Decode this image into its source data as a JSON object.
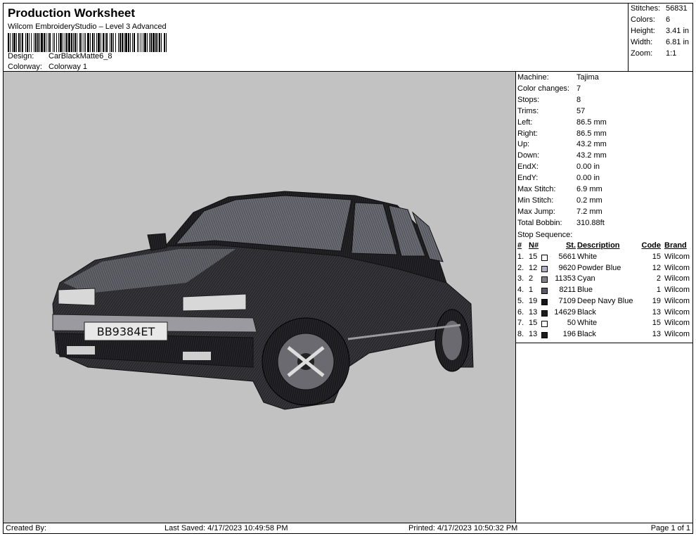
{
  "header": {
    "title": "Production Worksheet",
    "subtitle": "Wilcom EmbroideryStudio – Level 3 Advanced",
    "design_label": "Design:",
    "design_value": "CarBlackMatte6_8",
    "colorway_label": "Colorway:",
    "colorway_value": "Colorway 1"
  },
  "stats": [
    {
      "label": "Stitches:",
      "value": "56831"
    },
    {
      "label": "Colors:",
      "value": "6"
    },
    {
      "label": "Height:",
      "value": "3.41 in"
    },
    {
      "label": "Width:",
      "value": "6.81 in"
    },
    {
      "label": "Zoom:",
      "value": "1:1"
    }
  ],
  "machine_info": [
    {
      "label": "Machine:",
      "value": "Tajima"
    },
    {
      "label": "Color changes:",
      "value": "7"
    },
    {
      "label": "Stops:",
      "value": "8"
    },
    {
      "label": "Trims:",
      "value": "57"
    },
    {
      "label": "Left:",
      "value": "86.5 mm"
    },
    {
      "label": "Right:",
      "value": "86.5 mm"
    },
    {
      "label": "Up:",
      "value": "43.2 mm"
    },
    {
      "label": "Down:",
      "value": "43.2 mm"
    },
    {
      "label": "EndX:",
      "value": "0.00 in"
    },
    {
      "label": "EndY:",
      "value": "0.00 in"
    },
    {
      "label": "Max Stitch:",
      "value": "6.9 mm"
    },
    {
      "label": "Min Stitch:",
      "value": "0.2 mm"
    },
    {
      "label": "Max Jump:",
      "value": "7.2 mm"
    },
    {
      "label": "Total Bobbin:",
      "value": "310.88ft"
    }
  ],
  "stop_sequence": {
    "title": "Stop Sequence:",
    "headers": {
      "num": "#",
      "n": "N#",
      "st": "St.",
      "desc": "Description",
      "code": "Code",
      "brand": "Brand"
    },
    "rows": [
      {
        "num": "1.",
        "n": "15",
        "st": "5661",
        "desc": "White",
        "code": "15",
        "brand": "Wilcom",
        "color": "#ffffff"
      },
      {
        "num": "2.",
        "n": "12",
        "st": "9620",
        "desc": "Powder Blue",
        "code": "12",
        "brand": "Wilcom",
        "color": "#b0b0c8"
      },
      {
        "num": "3.",
        "n": "2",
        "st": "11353",
        "desc": "Cyan",
        "code": "2",
        "brand": "Wilcom",
        "color": "#808088"
      },
      {
        "num": "4.",
        "n": "1",
        "st": "8211",
        "desc": "Blue",
        "code": "1",
        "brand": "Wilcom",
        "color": "#58586a"
      },
      {
        "num": "5.",
        "n": "19",
        "st": "7109",
        "desc": "Deep Navy Blue",
        "code": "19",
        "brand": "Wilcom",
        "color": "#141418"
      },
      {
        "num": "6.",
        "n": "13",
        "st": "14629",
        "desc": "Black",
        "code": "13",
        "brand": "Wilcom",
        "color": "#1c1c1c"
      },
      {
        "num": "7.",
        "n": "15",
        "st": "50",
        "desc": "White",
        "code": "15",
        "brand": "Wilcom",
        "color": "#ffffff"
      },
      {
        "num": "8.",
        "n": "13",
        "st": "196",
        "desc": "Black",
        "code": "13",
        "brand": "Wilcom",
        "color": "#1c1c1c"
      }
    ]
  },
  "preview": {
    "background": "#c2c2c2",
    "plate_text": "BB9384ET"
  },
  "footer": {
    "created_by": "Created By:",
    "last_saved": "Last Saved: 4/17/2023 10:49:58 PM",
    "printed": "Printed: 4/17/2023 10:50:32 PM",
    "page": "Page 1 of 1"
  }
}
